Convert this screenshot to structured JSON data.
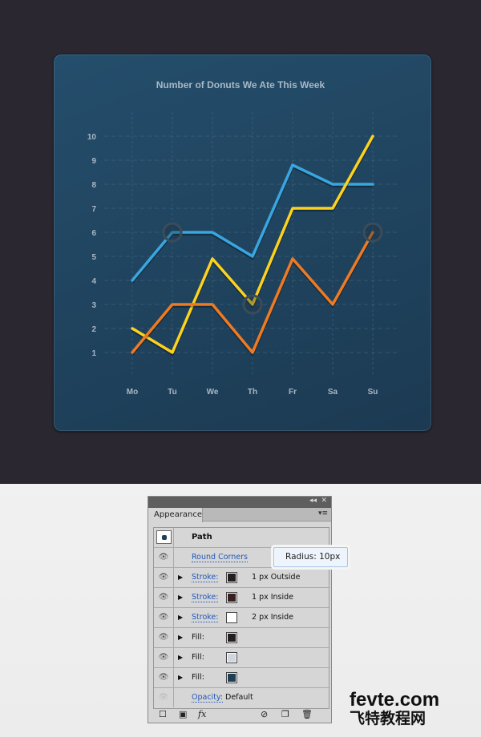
{
  "chart_data": {
    "type": "line",
    "title": "Number of Donuts We Ate This Week",
    "categories": [
      "Mo",
      "Tu",
      "We",
      "Th",
      "Fr",
      "Sa",
      "Su"
    ],
    "y_ticks": [
      1,
      2,
      3,
      4,
      5,
      6,
      7,
      8,
      9,
      10
    ],
    "ylim": [
      0,
      10
    ],
    "grid": true,
    "series": [
      {
        "color": "#39a6e0",
        "values": [
          4,
          6,
          6,
          5,
          8.8,
          8,
          8
        ],
        "highlight_index": 1
      },
      {
        "color": "#fdd21f",
        "values": [
          2,
          1,
          4.9,
          3,
          7,
          7,
          10
        ],
        "highlight_index": 3
      },
      {
        "color": "#ef7a22",
        "values": [
          1,
          3,
          3,
          1,
          4.9,
          3,
          6
        ],
        "highlight_index": 6
      }
    ]
  },
  "panel": {
    "title": "Appearance",
    "object": "Path",
    "rows": [
      {
        "label": "Round Corners",
        "link": true,
        "expand": false,
        "swatch": null,
        "value": ""
      },
      {
        "label": "Stroke:",
        "link": true,
        "expand": true,
        "swatch": "#231f20",
        "value": "1 px  Outside"
      },
      {
        "label": "Stroke:",
        "link": true,
        "expand": true,
        "swatch": "#3a1f22",
        "value": "1 px  Inside"
      },
      {
        "label": "Stroke:",
        "link": true,
        "expand": true,
        "swatch": "#ffffff",
        "value": "2 px  Inside"
      },
      {
        "label": "Fill:",
        "link": false,
        "expand": true,
        "swatch": "#231f20",
        "value": ""
      },
      {
        "label": "Fill:",
        "link": false,
        "expand": true,
        "swatch": "#cfd6dd",
        "value": ""
      },
      {
        "label": "Fill:",
        "link": false,
        "expand": true,
        "swatch": "#1e3f56",
        "value": ""
      }
    ],
    "opacity_label": "Opacity:",
    "opacity_value": "Default",
    "tooltip": "Radius: 10px",
    "fx": "fx"
  },
  "watermark": {
    "line1": "fevte.com",
    "line2": "飞特教程网"
  }
}
